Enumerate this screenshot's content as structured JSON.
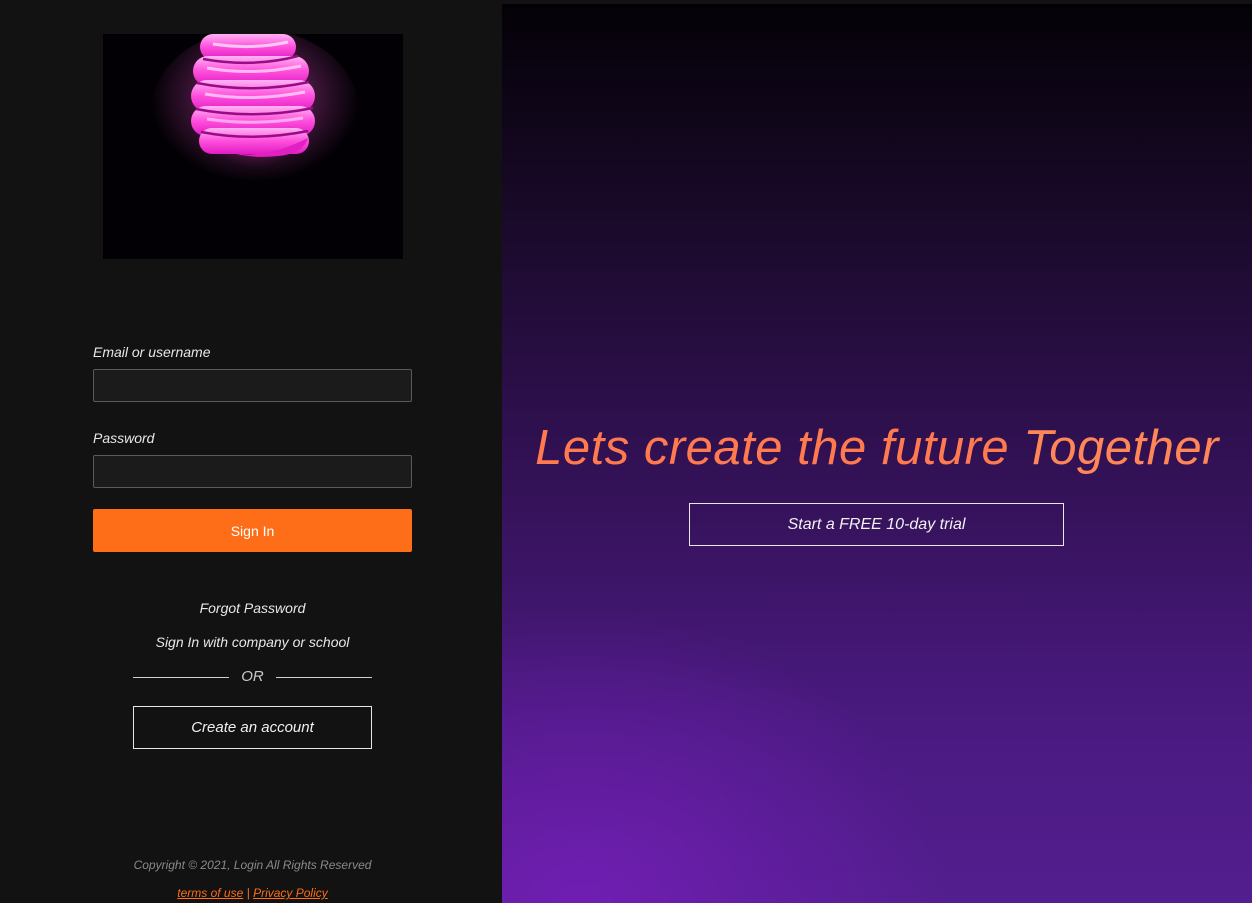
{
  "login": {
    "email_label": "Email or username",
    "email_value": "",
    "password_label": "Password",
    "password_value": "",
    "signin_label": "Sign In",
    "forgot_label": "Forgot Password",
    "company_signin_label": "Sign In with company or school",
    "or_label": "OR",
    "create_account_label": "Create an account"
  },
  "footer": {
    "copyright": "Copyright © 2021, Login All Rights Reserved",
    "terms_label": "terms of use",
    "separator": "|",
    "privacy_label": "Privacy Policy"
  },
  "hero": {
    "tagline_main": "Lets create the future ",
    "tagline_emphasis": "Together",
    "trial_label": "Start a FREE 10-day trial"
  },
  "icons": {
    "hero_image": "pink-spiral-lightbulb"
  },
  "colors": {
    "accent": "#fe6d17",
    "tagline": "#ff7a4e",
    "left_panel_bg": "#121212",
    "right_panel_bg_top": "#040106",
    "right_panel_bg_bottom": "#531e8f"
  }
}
